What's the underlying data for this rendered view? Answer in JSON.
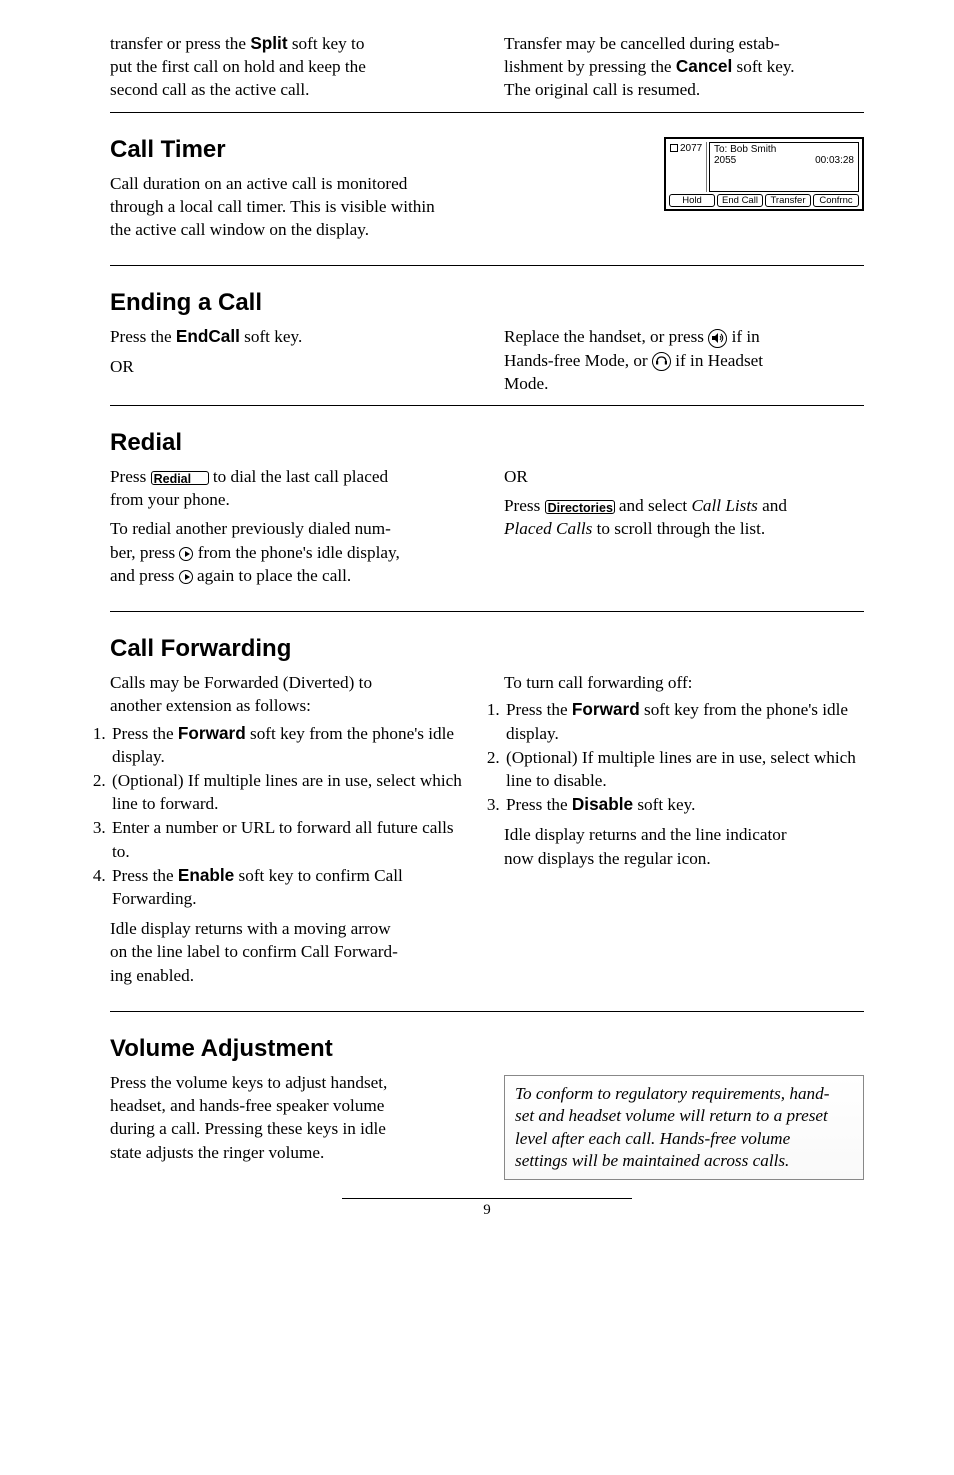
{
  "intro_left": {
    "l1a": "transfer or press the ",
    "l1b": "Split",
    "l1c": " soft key to ",
    "l2": "put the first call on hold and keep the ",
    "l3": "second call as the active call."
  },
  "intro_right": {
    "l1": "Transfer may be cancelled during estab-",
    "l2a": "lishment by pressing the ",
    "l2b": "Cancel",
    "l2c": " soft key. ",
    "l3": "The original call is resumed."
  },
  "call_timer": {
    "heading": "Call Timer",
    "l1": "Call duration on an active call is monitored ",
    "l2": "through a local call timer.  This is visible within ",
    "l3": "the active call window on the display."
  },
  "lcd": {
    "ext": "2077",
    "to": "To: Bob Smith",
    "from": "2055",
    "time": "00:03:28",
    "soft1": "Hold",
    "soft2": "End Call",
    "soft3": "Transfer",
    "soft4": "Confrnc"
  },
  "ending": {
    "heading": "Ending a Call",
    "left_l1a": "Press the ",
    "left_l1b": "EndCall",
    "left_l1c": " soft key.",
    "left_or": "OR",
    "right_l1a": "Replace the handset, or press ",
    "right_l1b": " if in ",
    "right_l2a": "Hands-free Mode, or ",
    "right_l2b": " if in Headset ",
    "right_l3": "Mode."
  },
  "redial": {
    "heading": "Redial",
    "left_l1a": "Press ",
    "left_btn1": "Redial",
    "left_l1b": " to dial the last call placed ",
    "left_l2": "from your phone.",
    "left_p2_l1": "To redial another previously dialed num-",
    "left_p2_l2a": "ber, press ",
    "left_p2_l2b": " from the phone's idle display, ",
    "left_p2_l3a": "and press ",
    "left_p2_l3b": " again to place the call.",
    "right_or": "OR",
    "right_l1a": "Press ",
    "right_btn": "Directories",
    "right_l1b": " and select  ",
    "right_l1_italic": "Call Lists",
    "right_l1c": " and ",
    "right_l2_italic": "Placed Calls",
    "right_l2b": " to scroll through the list."
  },
  "cf": {
    "heading": "Call Forwarding",
    "left_intro_l1": "Calls may be Forwarded (Diverted) to ",
    "left_intro_l2": "another extension as follows:",
    "left_items": [
      {
        "a": "Press the ",
        "b": "Forward",
        "c": " soft key from the phone's idle display."
      },
      {
        "a": "(Optional) If multiple lines are in use, select which line to forward."
      },
      {
        "a": "Enter a number or URL to forward all future calls to."
      },
      {
        "a": "Press the ",
        "b": "Enable",
        "c": " soft key to confirm Call Forwarding."
      }
    ],
    "left_tail_l1": "Idle display returns with a moving arrow ",
    "left_tail_l2": "on the line label to confirm Call Forward-",
    "left_tail_l3": "ing enabled.",
    "right_intro": "To turn call forwarding off:",
    "right_items": [
      {
        "a": "Press the ",
        "b": "Forward",
        "c": " soft key from the phone's idle display."
      },
      {
        "a": "(Optional) If multiple lines are in use, select which line to disable."
      },
      {
        "a": "Press the ",
        "b": "Disable",
        "c": " soft key."
      }
    ],
    "right_tail_l1": "Idle display returns and the line indicator ",
    "right_tail_l2": "now displays the regular icon."
  },
  "vol": {
    "heading": "Volume Adjustment",
    "left_l1": "Press the volume keys to adjust handset, ",
    "left_l2": "headset, and hands-free speaker volume ",
    "left_l3": "during a call.  Pressing these keys in idle ",
    "left_l4": "state adjusts the ringer volume.",
    "note_l1": "To conform to regulatory requirements, hand-",
    "note_l2": "set and headset volume will return to a preset ",
    "note_l3": "level after each call.  Hands-free volume ",
    "note_l4": "settings will be maintained across calls."
  },
  "page_number": "9"
}
